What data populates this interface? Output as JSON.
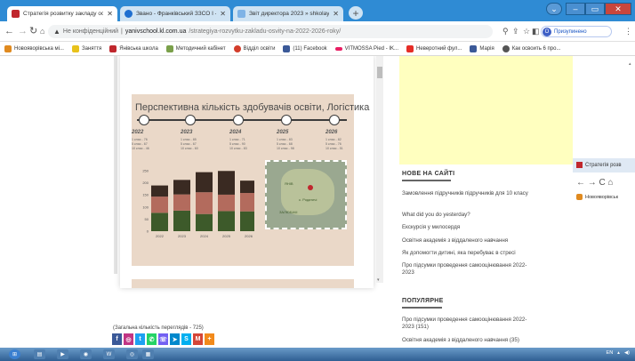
{
  "tabs": [
    {
      "label": "Стратегія розвитку закладу осв",
      "fav_color": "#c0272d"
    },
    {
      "label": "Звано - Франківський ЗЗСО І - ІІ",
      "fav_color": "#1f6fd0"
    },
    {
      "label": "Звіт директора 2023 » shkolaya:",
      "fav_color": "#7fb3e6"
    }
  ],
  "address": {
    "security_text": "Не конфіденційний",
    "host": "yanivschool.kl.com.ua",
    "path": "/strategiya-rozvytku-zakladu-osvity-na-2022-2026-roky/"
  },
  "profile": {
    "label": "Призупинено",
    "initial": "O"
  },
  "bookmarks": [
    {
      "label": "Новояворівська мі...",
      "color": "#e08a1f"
    },
    {
      "label": "Заняття",
      "color": "#e8c21b"
    },
    {
      "label": "Янівська школа",
      "color": "#c0272d"
    },
    {
      "label": "Методичний кабінет",
      "color": "#7aa04a"
    },
    {
      "label": "Відділ освіти",
      "color": "#d33d2b"
    },
    {
      "label": "(11) Facebook",
      "color": "#3b5998"
    },
    {
      "label": "VITMOSSA Pied - IK...",
      "color": "#e91e63"
    },
    {
      "label": "Неверотний фул...",
      "color": "#e52d27"
    },
    {
      "label": "Марія",
      "color": "#3b5998"
    },
    {
      "label": "Как освоить 6 про...",
      "color": "#555555"
    }
  ],
  "infographic": {
    "title": "Перспективна кількість здобувачів освіти, Логістика",
    "years": [
      {
        "year": "2022",
        "lines": [
          "1 клас - 76",
          "5 клас - 67",
          "10 клас - 46"
        ]
      },
      {
        "year": "2023",
        "lines": [
          "1 клас - 85",
          "5 клас - 67",
          "10 клас - 60"
        ]
      },
      {
        "year": "2024",
        "lines": [
          "1 клас - 71",
          "5 клас - 90",
          "10 клас - 83"
        ]
      },
      {
        "year": "2025",
        "lines": [
          "1 клас - 83",
          "5 клас - 68",
          "10 клас - 98"
        ]
      },
      {
        "year": "2026",
        "lines": [
          "1 клас - 82",
          "5 клас - 76",
          "10 клас - 51"
        ]
      }
    ],
    "map_labels": [
      "ЯНІВ",
      "с. Родатичі",
      "ЗАЛЮБАЧІ"
    ]
  },
  "chart_data": {
    "type": "bar",
    "stacked": true,
    "categories": [
      "2022",
      "2023",
      "2024",
      "2025",
      "2026"
    ],
    "y_ticks": [
      "0",
      "50",
      "100",
      "150",
      "200",
      "250"
    ],
    "ylim": [
      0,
      250
    ],
    "series": [
      {
        "color": "#3d5a2a",
        "values": [
          76,
          85,
          71,
          83,
          82
        ]
      },
      {
        "color": "#b36b5d",
        "values": [
          67,
          67,
          90,
          68,
          76
        ]
      },
      {
        "color": "#3a2a22",
        "values": [
          46,
          60,
          83,
          98,
          51
        ]
      }
    ]
  },
  "counter_text": "(Загальна кількість переглядів - 725)",
  "share_icons": [
    {
      "name": "facebook",
      "color": "#3b5998",
      "glyph": "f"
    },
    {
      "name": "instagram",
      "color": "#c13584",
      "glyph": "◎"
    },
    {
      "name": "twitter",
      "color": "#1da1f2",
      "glyph": "t"
    },
    {
      "name": "whatsapp",
      "color": "#25d366",
      "glyph": "✆"
    },
    {
      "name": "viber",
      "color": "#7360f2",
      "glyph": "☏"
    },
    {
      "name": "telegram",
      "color": "#0088cc",
      "glyph": "➤"
    },
    {
      "name": "skype",
      "color": "#00aff0",
      "glyph": "S"
    },
    {
      "name": "gmail",
      "color": "#d44638",
      "glyph": "M"
    },
    {
      "name": "more",
      "color": "#f28a1b",
      "glyph": "+"
    }
  ],
  "sidebar": {
    "new_heading": "НОВЕ НА САЙТІ",
    "new_items": [
      "Замовлення підручників підручників для 10 класу",
      "What did you do yesterday?",
      "Екскурсія у милосердя",
      "Освітня академія з віддаленого навчання",
      "Як допомогти дитині, яка перебуває в стресі",
      "Про підсумки проведення самооцінювання 2022-2023"
    ],
    "popular_heading": "ПОПУЛЯРНЕ",
    "popular_items": [
      "Про підсумки проведення самооцінювання 2022-2023 (151)",
      "Освітня академія з віддаленого навчання (35)"
    ]
  },
  "clip": {
    "tab_label": "Стратегія розв",
    "bookmark_label": "Новояворівськ"
  },
  "tray": {
    "lang": "EN"
  }
}
